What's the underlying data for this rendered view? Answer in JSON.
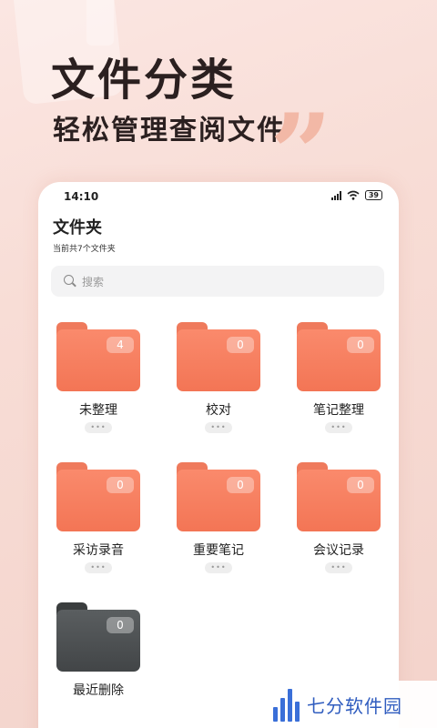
{
  "hero": {
    "title": "文件分类",
    "subtitle": "轻松管理查阅文件"
  },
  "status_bar": {
    "time": "14:10",
    "battery": "39"
  },
  "page": {
    "title": "文件夹",
    "subtitle": "当前共7个文件夹"
  },
  "search": {
    "placeholder": "搜索"
  },
  "folders": [
    {
      "name": "未整理",
      "count": "4",
      "color": "#f37555"
    },
    {
      "name": "校对",
      "count": "0",
      "color": "#f37555"
    },
    {
      "name": "笔记整理",
      "count": "0",
      "color": "#f37555"
    },
    {
      "name": "采访录音",
      "count": "0",
      "color": "#f37555"
    },
    {
      "name": "重要笔记",
      "count": "0",
      "color": "#f37555"
    },
    {
      "name": "会议记录",
      "count": "0",
      "color": "#f37555"
    },
    {
      "name": "最近删除",
      "count": "0",
      "color": "#424547"
    }
  ],
  "more_glyph": "•••",
  "watermark": {
    "text": "七分软件园"
  }
}
